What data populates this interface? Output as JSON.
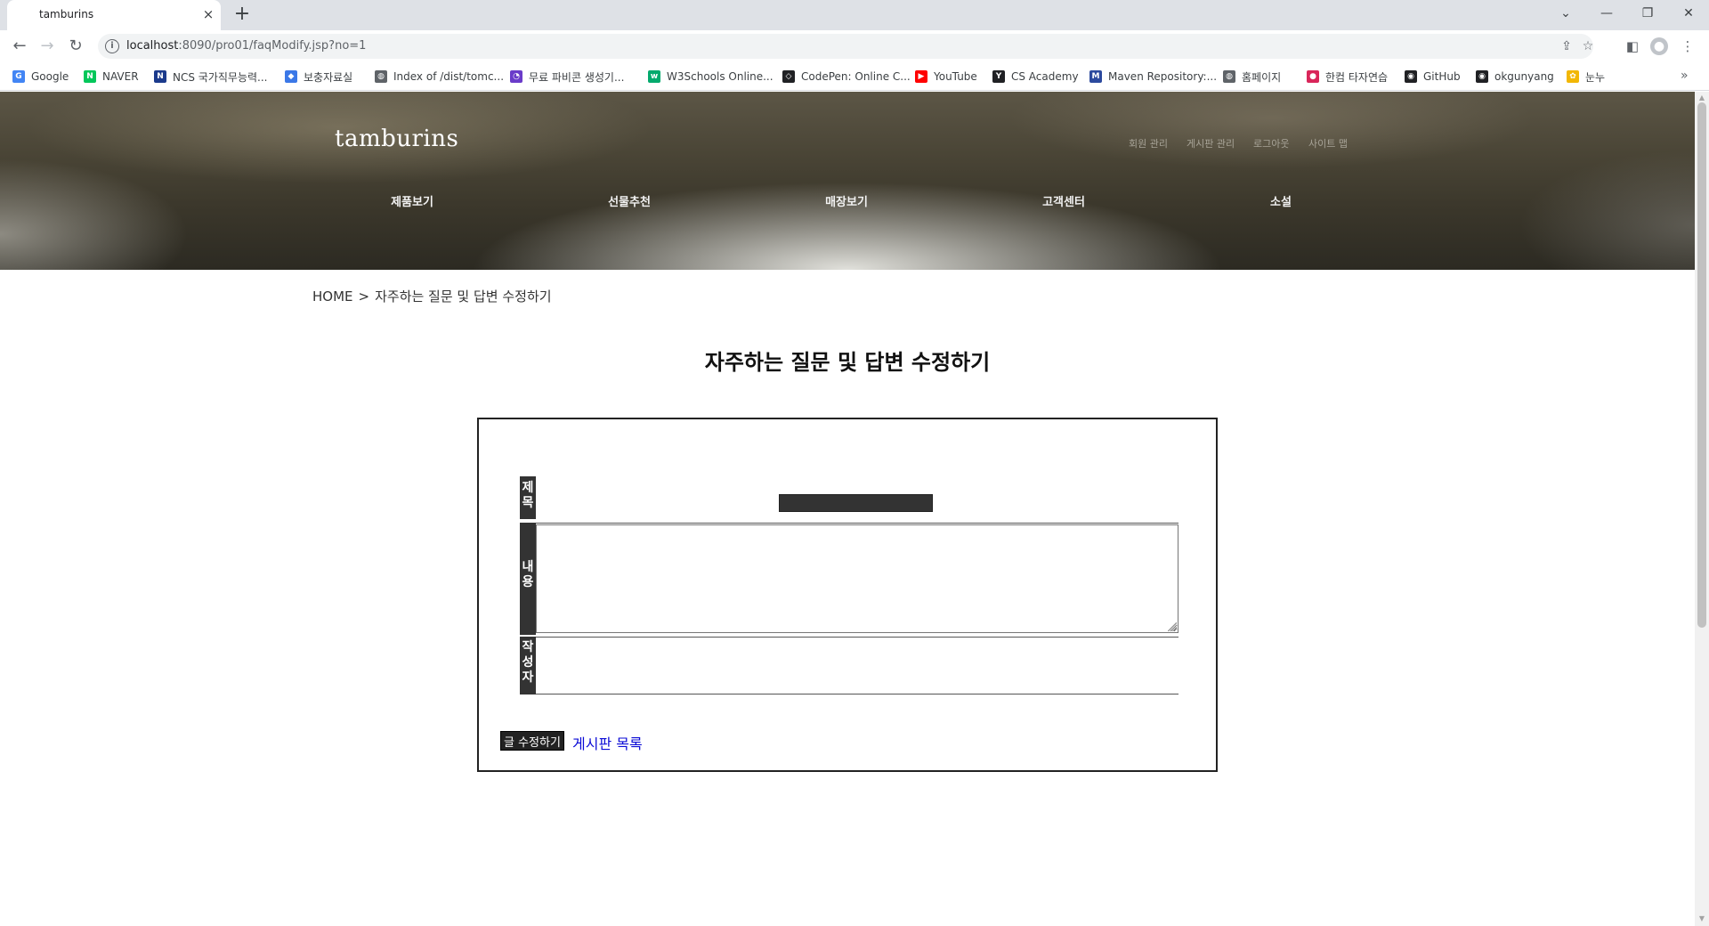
{
  "browser": {
    "tab_title": "tamburins",
    "tab_close": "×",
    "new_tab": "+",
    "url_host": "localhost",
    "url_rest": ":8090/pro01/faqModify.jsp?no=1",
    "info_glyph": "i"
  },
  "bookmarks": [
    {
      "label": "Google",
      "color": "#4285f4",
      "glyph": "G"
    },
    {
      "label": "NAVER",
      "color": "#03c75a",
      "glyph": "N"
    },
    {
      "label": "NCS 국가직무능력...",
      "color": "#1b3a8c",
      "glyph": "N"
    },
    {
      "label": "보충자료실",
      "color": "#3b78e7",
      "glyph": "◆"
    },
    {
      "label": "Index of /dist/tomc...",
      "color": "#5f6368",
      "glyph": "◍"
    },
    {
      "label": "무료 파비콘 생성기...",
      "color": "#6a3bc9",
      "glyph": "◔"
    },
    {
      "label": "W3Schools Online...",
      "color": "#04aa6d",
      "glyph": "w"
    },
    {
      "label": "CodePen: Online C...",
      "color": "#202124",
      "glyph": "◇"
    },
    {
      "label": "YouTube",
      "color": "#ff0000",
      "glyph": "▶"
    },
    {
      "label": "CS Academy",
      "color": "#202124",
      "glyph": "Y"
    },
    {
      "label": "Maven Repository:...",
      "color": "#2c4a9e",
      "glyph": "M"
    },
    {
      "label": "홈페이지",
      "color": "#5f6368",
      "glyph": "◍"
    },
    {
      "label": "한컴 타자연습",
      "color": "#d9265a",
      "glyph": "●"
    },
    {
      "label": "GitHub",
      "color": "#202124",
      "glyph": "◉"
    },
    {
      "label": "okgunyang",
      "color": "#202124",
      "glyph": "◉"
    },
    {
      "label": "눈누",
      "color": "#f2b705",
      "glyph": "✿"
    }
  ],
  "bookmarks_more": "»",
  "site": {
    "brand": "tamburins",
    "util_links": [
      "회원 관리",
      "게시판 관리",
      "로그아웃",
      "사이트 맵"
    ],
    "nav": [
      "제품보기",
      "선물추천",
      "매장보기",
      "고객센터",
      "소설"
    ]
  },
  "breadcrumb": {
    "home": "HOME",
    "sep": ">",
    "current": "자주하는 질문 및 답변 수정하기"
  },
  "page_title": "자주하는 질문 및 답변 수정하기",
  "form": {
    "title_label": "제목",
    "content_label": "내용",
    "author_label": "작성자",
    "title_value": "",
    "content_value": "",
    "author_value": "",
    "submit_label": "글 수정하기",
    "list_link": "게시판 목록"
  }
}
